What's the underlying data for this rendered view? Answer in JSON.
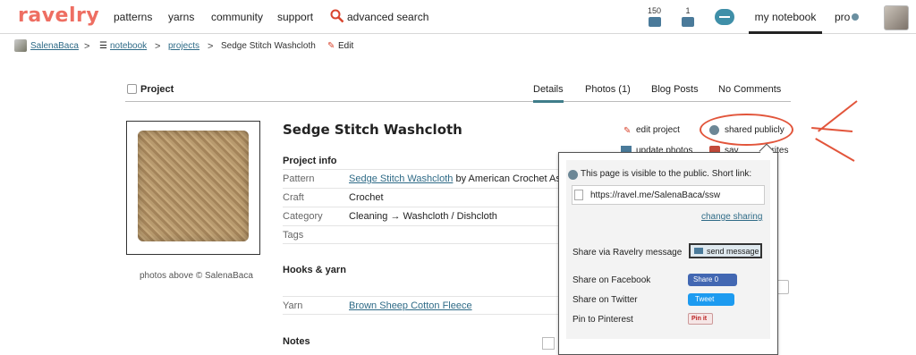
{
  "nav": {
    "logo": "ravelry",
    "items": [
      "patterns",
      "yarns",
      "community",
      "support"
    ],
    "search": "advanced search",
    "counts": [
      "150",
      "1"
    ],
    "my_notebook": "my notebook",
    "pro": "pro"
  },
  "breadcrumb": {
    "user": "SalenaBaca",
    "notebook": "notebook",
    "projects": "projects",
    "current": "Sedge Stitch Washcloth",
    "edit": "Edit"
  },
  "header": {
    "label": "Project",
    "tabs": [
      "Details",
      "Photos (1)",
      "Blog Posts",
      "No Comments"
    ]
  },
  "photo_credit": "photos above © SalenaBaca",
  "project": {
    "title": "Sedge Stitch Washcloth",
    "info_heading": "Project info",
    "rows": {
      "pattern_key": "Pattern",
      "pattern_link": "Sedge Stitch Washcloth",
      "pattern_suffix": " by American Crochet Ass",
      "craft_key": "Craft",
      "craft_val": "Crochet",
      "category_key": "Category",
      "category_val": "Cleaning → Washcloth / Dishcloth",
      "tags_key": "Tags"
    },
    "hooks_heading": "Hooks & yarn",
    "yarn_key": "Yarn",
    "yarn_link": "Brown Sheep Cotton Fleece",
    "notes_heading": "Notes"
  },
  "actions": {
    "edit_project": "edit project",
    "update_photos": "update photos",
    "save_favorites_a": "sav",
    "save_favorites_b": "vorites",
    "shared_publicly": "shared publicly"
  },
  "popup": {
    "visibility": "This page is visible to the public. Short link:",
    "short_link": "https://ravel.me/SalenaBaca/ssw",
    "change_sharing": "change sharing",
    "ravelry_label": "Share via Ravelry message",
    "send_message": "send message",
    "facebook_label": "Share on Facebook",
    "facebook_button": "Share 0",
    "twitter_label": "Share on Twitter",
    "twitter_button": "Tweet",
    "pinterest_label": "Pin to Pinterest",
    "pinterest_button": "Pin it"
  },
  "colors": {
    "brand": "#ee6e62",
    "link": "#2f6b87",
    "annotation": "#e2553b"
  }
}
